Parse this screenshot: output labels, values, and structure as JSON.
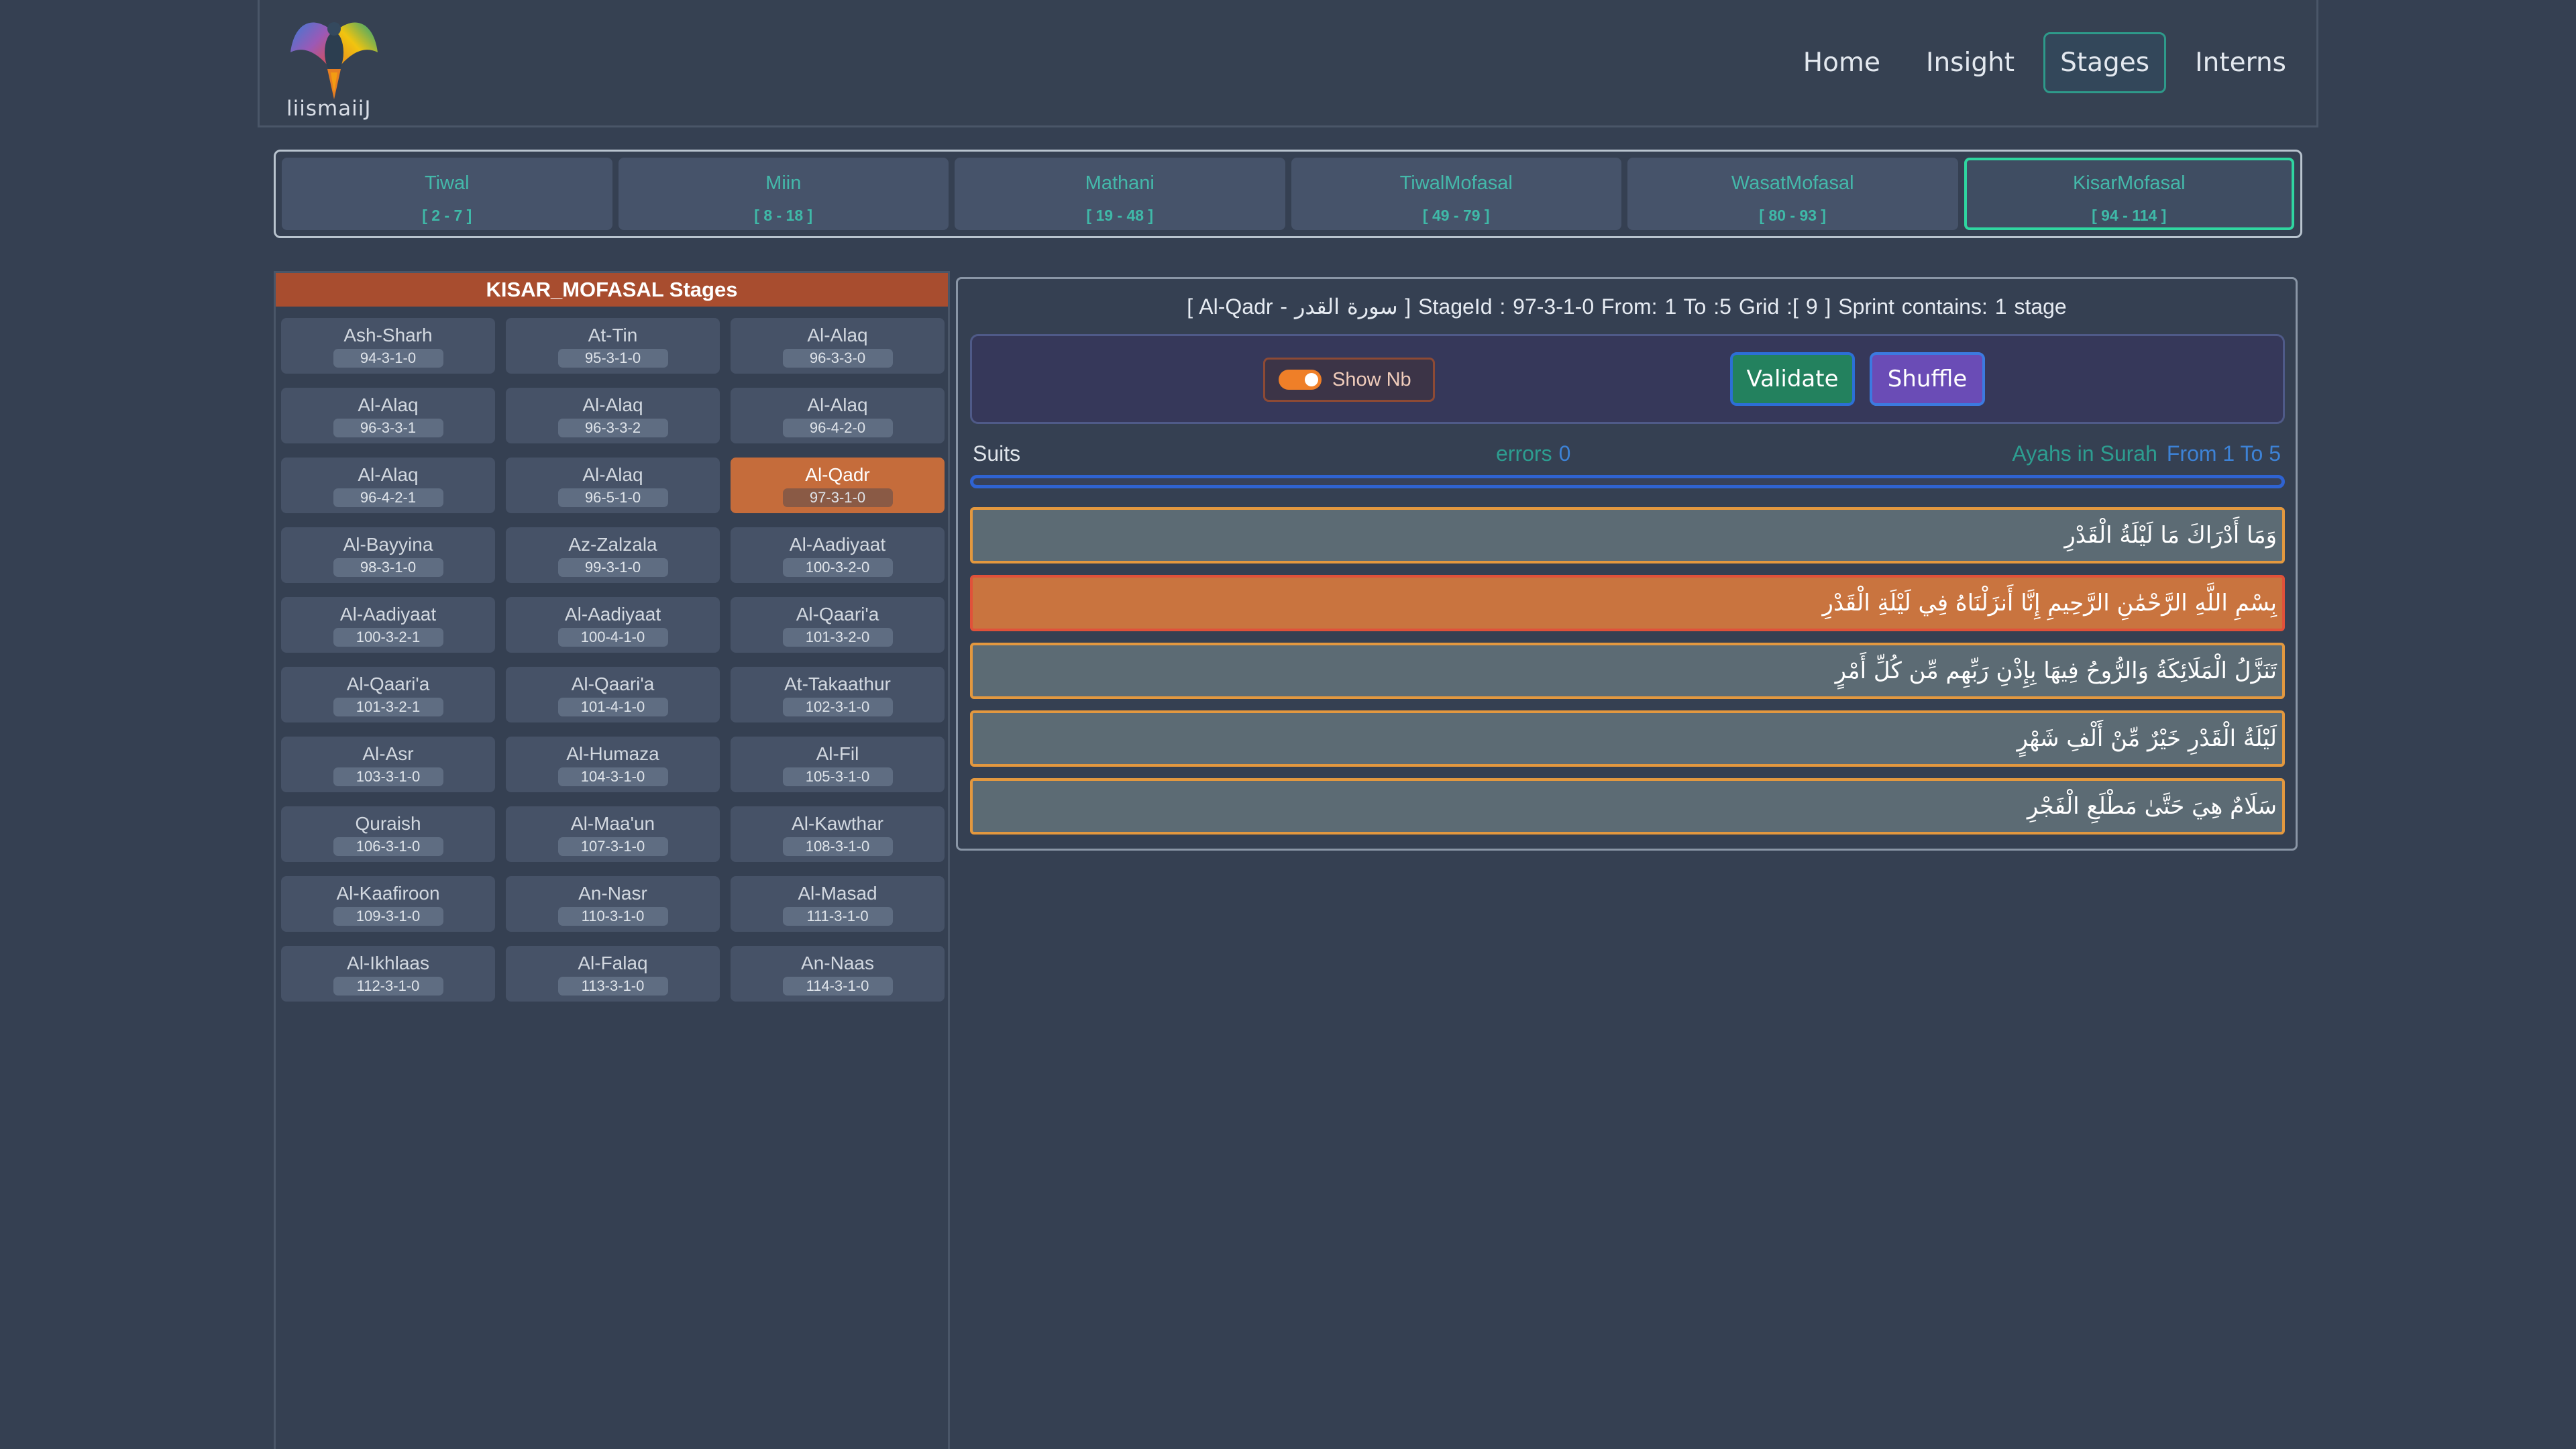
{
  "header": {
    "logo_text": "liismaiiJ",
    "nav": [
      "Home",
      "Insight",
      "Stages",
      "Interns"
    ]
  },
  "categories": [
    {
      "name": "Tiwal",
      "range": "[ 2 - 7 ]"
    },
    {
      "name": "Miin",
      "range": "[ 8 - 18 ]"
    },
    {
      "name": "Mathani",
      "range": "[ 19 - 48 ]"
    },
    {
      "name": "TiwalMofasal",
      "range": "[ 49 - 79 ]"
    },
    {
      "name": "WasatMofasal",
      "range": "[ 80 - 93 ]"
    },
    {
      "name": "KisarMofasal",
      "range": "[ 94 - 114 ]"
    }
  ],
  "stages_panel": {
    "title": "KISAR_MOFASAL Stages",
    "stages": [
      {
        "name": "Ash-Sharh",
        "id": "94-3-1-0"
      },
      {
        "name": "At-Tin",
        "id": "95-3-1-0"
      },
      {
        "name": "Al-Alaq",
        "id": "96-3-3-0"
      },
      {
        "name": "Al-Alaq",
        "id": "96-3-3-1"
      },
      {
        "name": "Al-Alaq",
        "id": "96-3-3-2"
      },
      {
        "name": "Al-Alaq",
        "id": "96-4-2-0"
      },
      {
        "name": "Al-Alaq",
        "id": "96-4-2-1"
      },
      {
        "name": "Al-Alaq",
        "id": "96-5-1-0"
      },
      {
        "name": "Al-Qadr",
        "id": "97-3-1-0"
      },
      {
        "name": "Al-Bayyina",
        "id": "98-3-1-0"
      },
      {
        "name": "Az-Zalzala",
        "id": "99-3-1-0"
      },
      {
        "name": "Al-Aadiyaat",
        "id": "100-3-2-0"
      },
      {
        "name": "Al-Aadiyaat",
        "id": "100-3-2-1"
      },
      {
        "name": "Al-Aadiyaat",
        "id": "100-4-1-0"
      },
      {
        "name": "Al-Qaari'a",
        "id": "101-3-2-0"
      },
      {
        "name": "Al-Qaari'a",
        "id": "101-3-2-1"
      },
      {
        "name": "Al-Qaari'a",
        "id": "101-4-1-0"
      },
      {
        "name": "At-Takaathur",
        "id": "102-3-1-0"
      },
      {
        "name": "Al-Asr",
        "id": "103-3-1-0"
      },
      {
        "name": "Al-Humaza",
        "id": "104-3-1-0"
      },
      {
        "name": "Al-Fil",
        "id": "105-3-1-0"
      },
      {
        "name": "Quraish",
        "id": "106-3-1-0"
      },
      {
        "name": "Al-Maa'un",
        "id": "107-3-1-0"
      },
      {
        "name": "Al-Kawthar",
        "id": "108-3-1-0"
      },
      {
        "name": "Al-Kaafiroon",
        "id": "109-3-1-0"
      },
      {
        "name": "An-Nasr",
        "id": "110-3-1-0"
      },
      {
        "name": "Al-Masad",
        "id": "111-3-1-0"
      },
      {
        "name": "Al-Ikhlaas",
        "id": "112-3-1-0"
      },
      {
        "name": "Al-Falaq",
        "id": "113-3-1-0"
      },
      {
        "name": "An-Naas",
        "id": "114-3-1-0"
      }
    ]
  },
  "exercise": {
    "info": "[ Al-Qadr - سورة القدر ] StageId : 97-3-1-0  From: 1   To :5   Grid :[ 9 ]  Sprint contains:  1 stage",
    "toggle_label": "Show Nb",
    "validate_label": "Validate",
    "shuffle_label": "Shuffle",
    "suits_label": "Suits",
    "errors_label": "errors",
    "errors_count": "0",
    "ayahs_label": "Ayahs in Surah",
    "ayahs_range": "From 1 To 5",
    "verses": [
      "وَمَا أَدْرَاكَ مَا لَيْلَةُ الْقَدْرِ",
      "بِسْمِ اللَّهِ الرَّحْمَٰنِ الرَّحِيمِ إِنَّا أَنزَلْنَاهُ فِي لَيْلَةِ الْقَدْرِ",
      "تَنَزَّلُ الْمَلَائِكَةُ وَالرُّوحُ فِيهَا بِإِذْنِ رَبِّهِم مِّن كُلِّ أَمْرٍ",
      "لَيْلَةُ الْقَدْرِ خَيْرٌ مِّنْ أَلْفِ شَهْرٍ",
      "سَلَامٌ هِيَ حَتَّىٰ مَطْلَعِ الْفَجْرِ"
    ]
  },
  "colors": {
    "background": "#354052",
    "accent_teal": "#2fd6a0",
    "active_stage": "#c56c3b",
    "verse_border": "#e3983f",
    "validate": "#23815e",
    "shuffle": "#6a4cb6"
  }
}
